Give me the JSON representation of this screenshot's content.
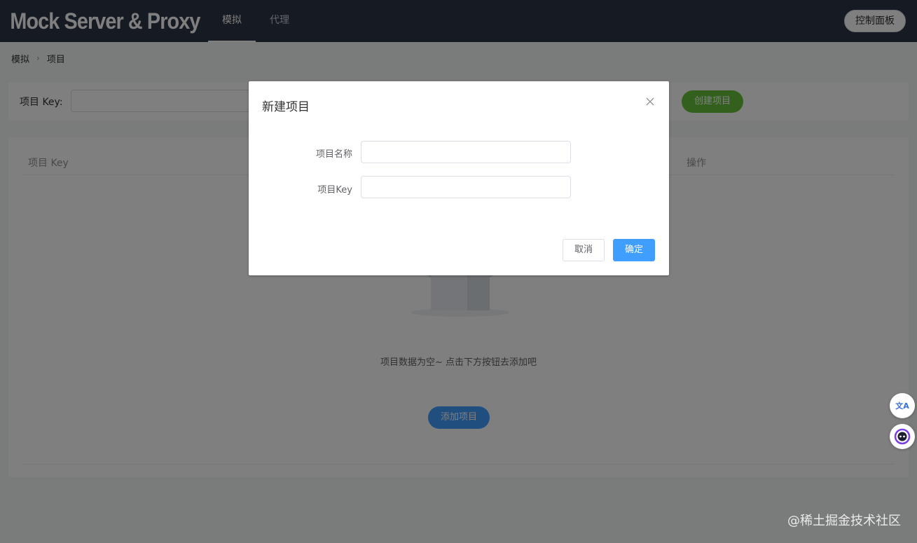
{
  "header": {
    "brand": "Mock Server & Proxy",
    "tabs": [
      {
        "label": "模拟",
        "active": true
      },
      {
        "label": "代理",
        "active": false
      }
    ],
    "control_panel_label": "控制面板"
  },
  "breadcrumb": {
    "items": [
      "模拟",
      "项目"
    ]
  },
  "search": {
    "label": "项目 Key:",
    "value": "",
    "create_button_label": "创建项目"
  },
  "table": {
    "columns": [
      "项目 Key",
      "操作"
    ],
    "empty_text": "项目数据为空~ 点击下方按钮去添加吧",
    "add_button_label": "添加项目"
  },
  "dialog": {
    "title": "新建项目",
    "fields": [
      {
        "label": "项目名称",
        "value": ""
      },
      {
        "label": "项目Key",
        "value": ""
      }
    ],
    "cancel_label": "取消",
    "confirm_label": "确定"
  },
  "floating": {
    "translate_glyph": "文A"
  },
  "watermark": "@稀土掘金技术社区",
  "colors": {
    "header_bg": "#2c3445",
    "primary": "#409eff",
    "success": "#67c23a"
  }
}
